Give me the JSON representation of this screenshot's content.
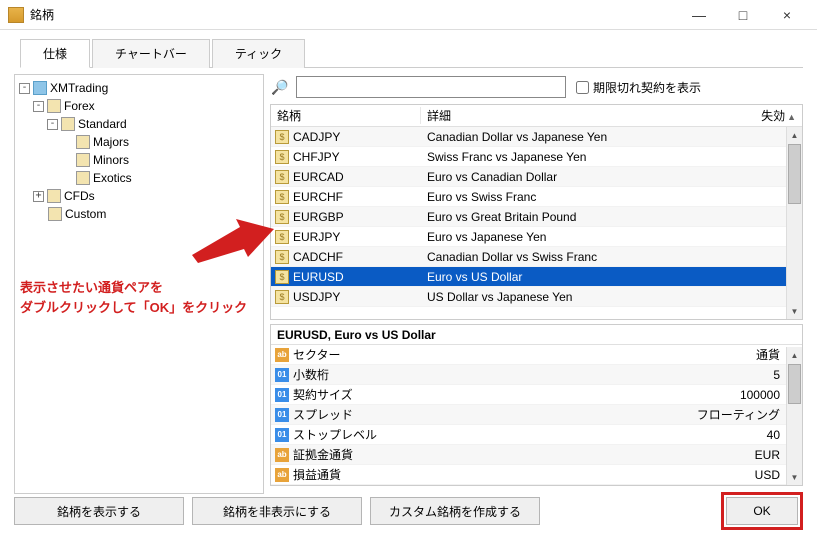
{
  "window": {
    "title": "銘柄",
    "min": "—",
    "max": "□",
    "close": "×"
  },
  "tabs": {
    "spec": "仕様",
    "chartbar": "チャートバー",
    "tick": "ティック"
  },
  "tree": {
    "root": "XMTrading",
    "forex": "Forex",
    "standard": "Standard",
    "majors": "Majors",
    "minors": "Minors",
    "exotics": "Exotics",
    "cfds": "CFDs",
    "custom": "Custom"
  },
  "search": {
    "checkbox_label": "期限切れ契約を表示"
  },
  "grid": {
    "headers": {
      "symbol": "銘柄",
      "detail": "詳細",
      "disabled": "失効"
    },
    "rows": [
      {
        "sym": "CADJPY",
        "desc": "Canadian Dollar vs Japanese Yen"
      },
      {
        "sym": "CHFJPY",
        "desc": "Swiss Franc vs Japanese Yen"
      },
      {
        "sym": "EURCAD",
        "desc": "Euro vs Canadian Dollar"
      },
      {
        "sym": "EURCHF",
        "desc": "Euro vs Swiss Franc"
      },
      {
        "sym": "EURGBP",
        "desc": "Euro vs Great Britain Pound"
      },
      {
        "sym": "EURJPY",
        "desc": "Euro vs Japanese Yen"
      },
      {
        "sym": "CADCHF",
        "desc": "Canadian Dollar vs Swiss Franc"
      },
      {
        "sym": "EURUSD",
        "desc": "Euro vs US Dollar",
        "selected": true
      },
      {
        "sym": "USDJPY",
        "desc": "US Dollar vs Japanese Yen"
      }
    ]
  },
  "detail": {
    "title": "EURUSD, Euro vs US Dollar",
    "rows": [
      {
        "icon": "ab",
        "k": "セクター",
        "v": "通貨"
      },
      {
        "icon": "o1",
        "k": "小数桁",
        "v": "5"
      },
      {
        "icon": "o1",
        "k": "契約サイズ",
        "v": "100000"
      },
      {
        "icon": "o1",
        "k": "スプレッド",
        "v": "フローティング"
      },
      {
        "icon": "o1",
        "k": "ストップレベル",
        "v": "40"
      },
      {
        "icon": "ab",
        "k": "証拠金通貨",
        "v": "EUR"
      },
      {
        "icon": "ab",
        "k": "損益通貨",
        "v": "USD"
      }
    ]
  },
  "buttons": {
    "show": "銘柄を表示する",
    "hide": "銘柄を非表示にする",
    "custom": "カスタム銘柄を作成する",
    "ok": "OK"
  },
  "annotation": {
    "text": "表示させたい通貨ペアを\nダブルクリックして「OK」をクリック"
  }
}
